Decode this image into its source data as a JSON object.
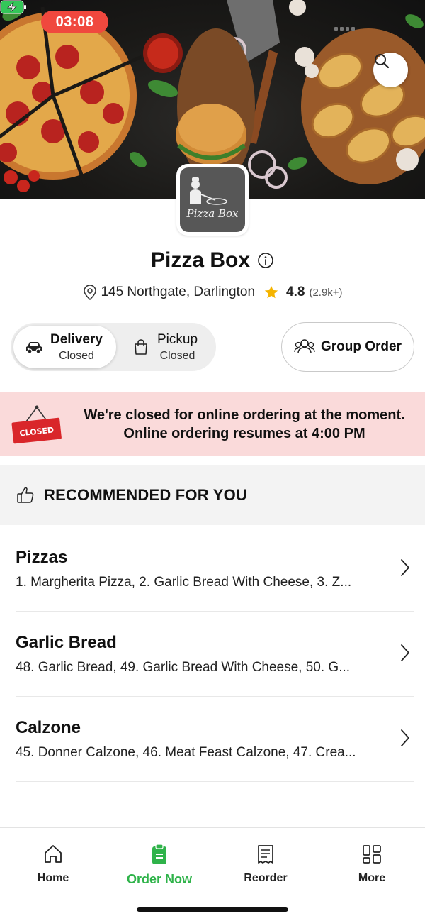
{
  "status_bar": {
    "time": "03:08"
  },
  "hero": {
    "search_icon": "search-icon",
    "logo_text": "Pizza Box"
  },
  "restaurant": {
    "name": "Pizza Box",
    "address": "145 Northgate, Darlington",
    "rating": "4.8",
    "rating_count": "(2.9k+)"
  },
  "modes": {
    "delivery": {
      "label": "Delivery",
      "status": "Closed",
      "icon": "car-icon",
      "selected": true
    },
    "pickup": {
      "label": "Pickup",
      "status": "Closed",
      "icon": "bag-icon",
      "selected": false
    },
    "group_order": {
      "label": "Group Order",
      "icon": "group-icon"
    }
  },
  "closed_banner": {
    "sign_text": "CLOSED",
    "line1": "We're closed for online ordering at the moment.",
    "line2": "Online ordering resumes at 4:00 PM"
  },
  "recommended": {
    "title": "RECOMMENDED FOR YOU",
    "categories": [
      {
        "name": "Pizzas",
        "items": "1. Margherita Pizza, 2. Garlic Bread With Cheese, 3. Z..."
      },
      {
        "name": "Garlic Bread",
        "items": "48. Garlic Bread, 49. Garlic Bread With Cheese, 50. G..."
      },
      {
        "name": "Calzone",
        "items": "45. Donner Calzone, 46. Meat Feast Calzone, 47. Crea..."
      }
    ]
  },
  "bottom_nav": [
    {
      "label": "Home",
      "icon": "home-icon",
      "active": false
    },
    {
      "label": "Order Now",
      "icon": "order-icon",
      "active": true
    },
    {
      "label": "Reorder",
      "icon": "receipt-icon",
      "active": false
    },
    {
      "label": "More",
      "icon": "grid-icon",
      "active": false
    }
  ],
  "colors": {
    "accent_green": "#2fb34a",
    "time_pill": "#f0483e",
    "closed_banner_bg": "#fadada",
    "closed_sign": "#d9262a",
    "star": "#f5b400"
  }
}
